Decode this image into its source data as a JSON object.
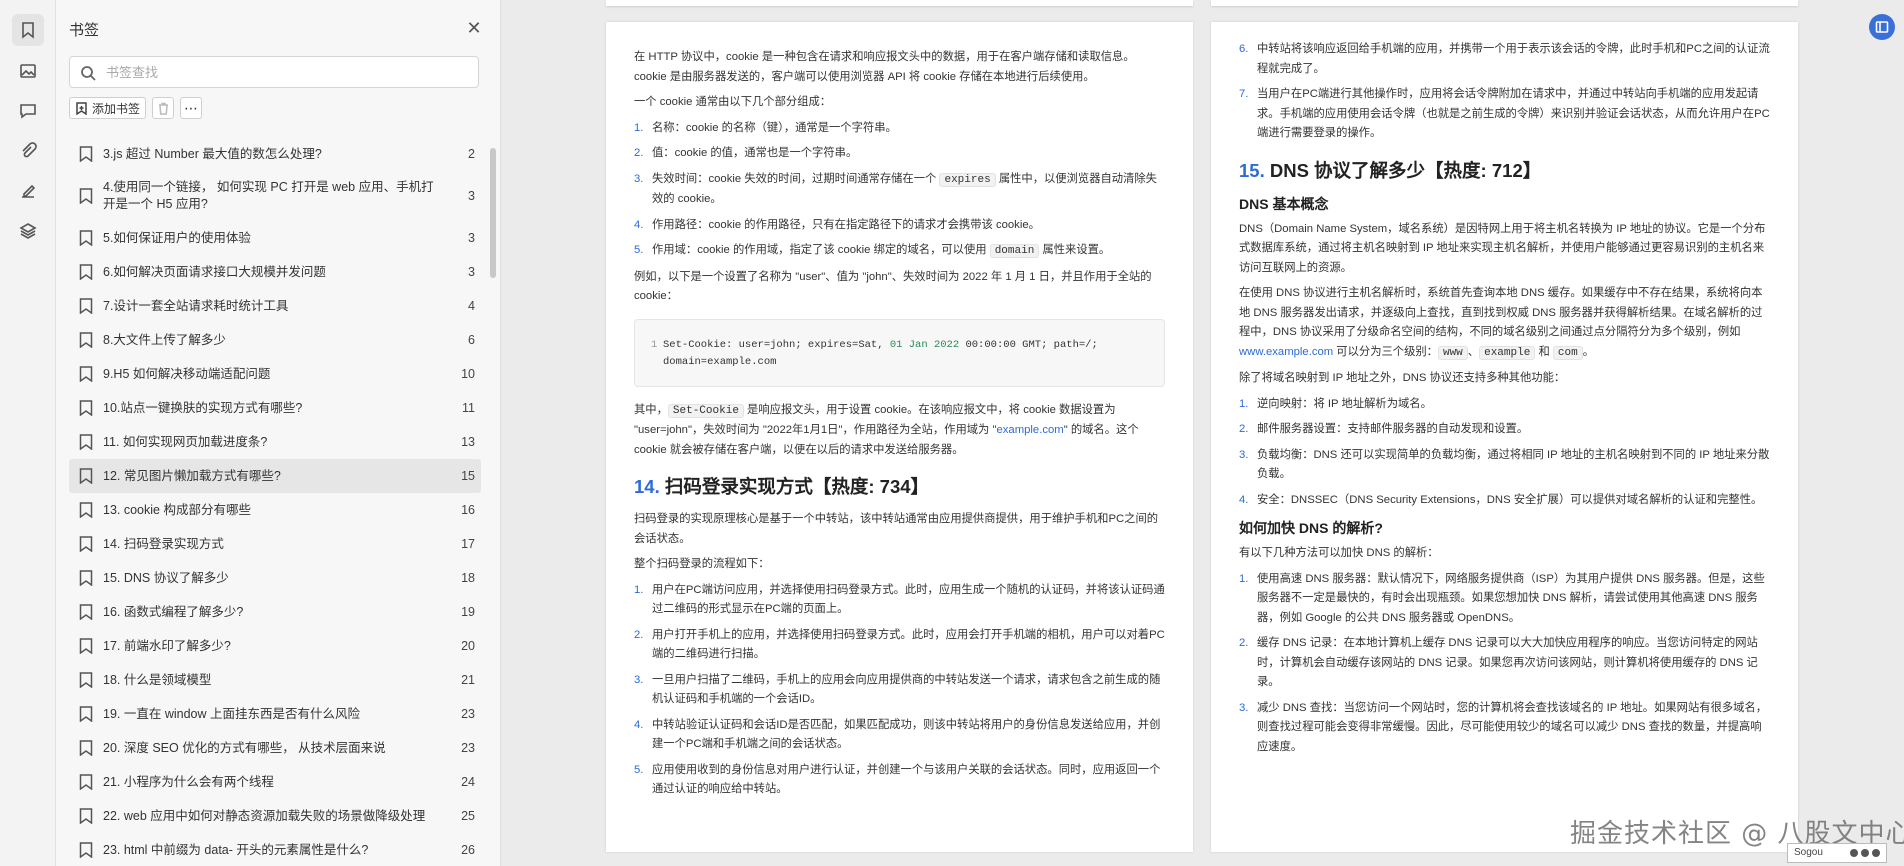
{
  "sidebar_tools": {
    "icons": [
      "bookmark-icon",
      "image-icon",
      "comment-icon",
      "attachment-icon",
      "signature-icon",
      "layers-icon"
    ]
  },
  "bookmarks_panel": {
    "title": "书签",
    "search_placeholder": "书签查找",
    "add_bookmark_label": "添加书签",
    "items": [
      {
        "label": "3.js 超过 Number 最大值的数怎么处理?",
        "page": "2"
      },
      {
        "label": "4.使用同一个链接， 如何实现 PC 打开是 web 应用、手机打 开是一个 H5 应用?",
        "page": "3"
      },
      {
        "label": "5.如何保证用户的使用体验",
        "page": "3"
      },
      {
        "label": "6.如何解决页面请求接口大规模并发问题",
        "page": "3"
      },
      {
        "label": "7.设计一套全站请求耗时统计工具",
        "page": "4"
      },
      {
        "label": "8.大文件上传了解多少",
        "page": "6"
      },
      {
        "label": "9.H5 如何解决移动端适配问题",
        "page": "10"
      },
      {
        "label": "10.站点一键换肤的实现方式有哪些?",
        "page": "11"
      },
      {
        "label": "11. 如何实现网页加载进度条?",
        "page": "13"
      },
      {
        "label": "12. 常见图片懒加载方式有哪些?",
        "page": "15"
      },
      {
        "label": "13. cookie 构成部分有哪些",
        "page": "16"
      },
      {
        "label": "14. 扫码登录实现方式",
        "page": "17"
      },
      {
        "label": "15. DNS 协议了解多少",
        "page": "18"
      },
      {
        "label": "16. 函数式编程了解多少?",
        "page": "19"
      },
      {
        "label": "17. 前端水印了解多少?",
        "page": "20"
      },
      {
        "label": "18. 什么是领域模型",
        "page": "21"
      },
      {
        "label": "19. 一直在 window 上面挂东西是否有什么风险",
        "page": "23"
      },
      {
        "label": "20. 深度 SEO 优化的方式有哪些， 从技术层面来说",
        "page": "23"
      },
      {
        "label": "21. 小程序为什么会有两个线程",
        "page": "24"
      },
      {
        "label": "22. web 应用中如何对静态资源加载失败的场景做降级处理",
        "page": "25"
      },
      {
        "label": "23. html 中前缀为 data- 开头的元素属性是什么?",
        "page": "26"
      }
    ]
  },
  "page_left": {
    "intro1": "在 HTTP 协议中，cookie 是一种包含在请求和响应报文头中的数据，用于在客户端存储和读取信息。cookie 是由服务器发送的，客户端可以使用浏览器 API 将 cookie 存储在本地进行后续使用。",
    "intro2": "一个 cookie 通常由以下几个部分组成：",
    "parts": [
      {
        "n": "1.",
        "a": "名称：cookie 的名称（键），通常是一个字符串。",
        "code": "",
        "b": ""
      },
      {
        "n": "2.",
        "a": "值：cookie 的值，通常也是一个字符串。",
        "code": "",
        "b": ""
      },
      {
        "n": "3.",
        "a": "失效时间：cookie 失效的时间，过期时间通常存储在一个 ",
        "code": "expires",
        "b": " 属性中，以便浏览器自动清除失效的 cookie。"
      },
      {
        "n": "4.",
        "a": "作用路径：cookie 的作用路径，只有在指定路径下的请求才会携带该 cookie。",
        "code": "",
        "b": ""
      },
      {
        "n": "5.",
        "a": "作用域：cookie 的作用域，指定了该 cookie 绑定的域名，可以使用 ",
        "code": "domain",
        "b": " 属性来设置。"
      }
    ],
    "example": "例如，以下是一个设置了名称为 \"user\"、值为 \"john\"、失效时间为 2022 年 1 月 1 日，并且作用于全站的 cookie：",
    "code_line_no": "1",
    "code_line1a": "Set-Cookie: user=john; expires=Sat, ",
    "code_date": "01 Jan 2022",
    "code_line1b": " 00:00:00 GMT; path=/;",
    "code_line2": "domain=example.com",
    "explain_a": "其中，",
    "explain_code": "Set-Cookie",
    "explain_b": " 是响应报文头，用于设置 cookie。在该响应报文中，将 cookie 数据设置为 \"user=john\"，失效时间为 \"2022年1月1日\"，作用路径为全站，作用域为 \"",
    "explain_link": "example.com",
    "explain_c": "\" 的域名。这个 cookie 就会被存储在客户端，以便在以后的请求中发送给服务器。",
    "h14_num": "14.",
    "h14_title": "扫码登录实现方式【热度: 734】",
    "scan_intro": "扫码登录的实现原理核心是基于一个中转站，该中转站通常由应用提供商提供，用于维护手机和PC之间的会话状态。",
    "scan_flow": "整个扫码登录的流程如下：",
    "steps": [
      {
        "n": "1.",
        "t": "用户在PC端访问应用，并选择使用扫码登录方式。此时，应用生成一个随机的认证码，并将该认证码通过二维码的形式显示在PC端的页面上。"
      },
      {
        "n": "2.",
        "t": "用户打开手机上的应用，并选择使用扫码登录方式。此时，应用会打开手机端的相机，用户可以对着PC端的二维码进行扫描。"
      },
      {
        "n": "3.",
        "t": "一旦用户扫描了二维码，手机上的应用会向应用提供商的中转站发送一个请求，请求包含之前生成的随机认证码和手机端的一个会话ID。"
      },
      {
        "n": "4.",
        "t": "中转站验证认证码和会话ID是否匹配，如果匹配成功，则该中转站将用户的身份信息发送给应用，并创建一个PC端和手机端之间的会话状态。"
      },
      {
        "n": "5.",
        "t": "应用使用收到的身份信息对用户进行认证，并创建一个与该用户关联的会话状态。同时，应用返回一个通过认证的响应给中转站。"
      }
    ]
  },
  "page_right": {
    "steps": [
      {
        "n": "6.",
        "t": "中转站将该响应返回给手机端的应用，并携带一个用于表示该会话的令牌，此时手机和PC之间的认证流程就完成了。"
      },
      {
        "n": "7.",
        "t": "当用户在PC端进行其他操作时，应用将会话令牌附加在请求中，并通过中转站向手机端的应用发起请求。手机端的应用使用会话令牌（也就是之前生成的令牌）来识别并验证会话状态，从而允许用户在PC端进行需要登录的操作。"
      }
    ],
    "h15_num": "15.",
    "h15_title": "DNS 协议了解多少【热度: 712】",
    "h_basic": "DNS 基本概念",
    "dns1": "DNS（Domain Name System，域名系统）是因特网上用于将主机名转换为 IP 地址的协议。它是一个分布式数据库系统，通过将主机名映射到 IP 地址来实现主机名解析，并使用户能够通过更容易识别的主机名来访问互联网上的资源。",
    "dns2a": "在使用 DNS 协议进行主机名解析时，系统首先查询本地 DNS 缓存。如果缓存中不存在结果，系统将向本地 DNS 服务器发出请求，并逐级向上查找，直到找到权威 DNS 服务器并获得解析结果。在域名解析的过程中，DNS 协议采用了分级命名空间的结构，不同的域名级别之间通过点分隔符分为多个级别，例如 ",
    "dns2_link": "www.example.com",
    "dns2b": " 可以分为三个级别：",
    "dns2_c1": "www",
    "dns2_sep": "、",
    "dns2_c2": "example",
    "dns2_and": " 和 ",
    "dns2_c3": "com",
    "dns2_end": "。",
    "dns3": "除了将域名映射到 IP 地址之外，DNS 协议还支持多种其他功能：",
    "features": [
      {
        "n": "1.",
        "t": "逆向映射：将 IP 地址解析为域名。"
      },
      {
        "n": "2.",
        "t": "邮件服务器设置：支持邮件服务器的自动发现和设置。"
      },
      {
        "n": "3.",
        "t": "负载均衡：DNS 还可以实现简单的负载均衡，通过将相同 IP 地址的主机名映射到不同的 IP 地址来分散负载。"
      },
      {
        "n": "4.",
        "t": "安全：DNSSEC（DNS Security Extensions，DNS 安全扩展）可以提供对域名解析的认证和完整性。"
      }
    ],
    "h_speed": "如何加快 DNS 的解析?",
    "speed_intro": "有以下几种方法可以加快 DNS 的解析：",
    "speed": [
      {
        "n": "1.",
        "t": "使用高速 DNS 服务器：默认情况下，网络服务提供商（ISP）为其用户提供 DNS 服务器。但是，这些服务器不一定是最快的，有时会出现瓶颈。如果您想加快 DNS 解析，请尝试使用其他高速 DNS 服务器，例如 Google 的公共 DNS 服务器或 OpenDNS。"
      },
      {
        "n": "2.",
        "t": "缓存 DNS 记录：在本地计算机上缓存 DNS 记录可以大大加快应用程序的响应。当您访问特定的网站时，计算机会自动缓存该网站的 DNS 记录。如果您再次访问该网站，则计算机将使用缓存的 DNS 记录。"
      },
      {
        "n": "3.",
        "t": "减少 DNS 查找：当您访问一个网站时，您的计算机将会查找该域名的 IP 地址。如果网站有很多域名，则查找过程可能会变得非常缓慢。因此，尽可能使用较少的域名可以减少 DNS 查找的数量，并提高响应速度。"
      }
    ]
  },
  "watermark": "掘金技术社区 @ 八股文中心",
  "ime_label": "Sogou"
}
